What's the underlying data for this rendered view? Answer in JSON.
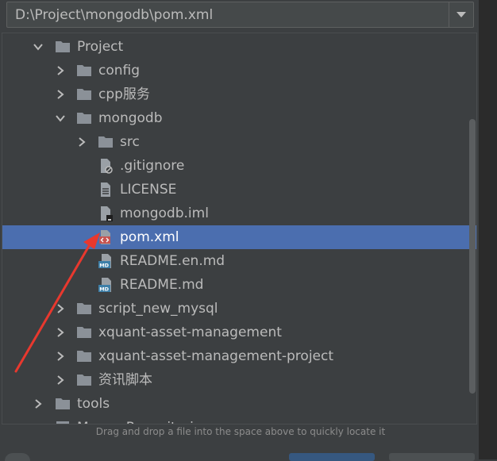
{
  "path_value": "D:\\Project\\mongodb\\pom.xml",
  "hint": "Drag and drop a file into the space above to quickly locate it",
  "tree": {
    "project": "Project",
    "config": "config",
    "cpp": "cpp服务",
    "mongodb": "mongodb",
    "src": "src",
    "gitignore": ".gitignore",
    "license": "LICENSE",
    "iml": "mongodb.iml",
    "pom": "pom.xml",
    "readme_en": "README.en.md",
    "readme": "README.md",
    "script": "script_new_mysql",
    "xqam": "xquant-asset-management",
    "xqamp": "xquant-asset-management-project",
    "zixun": "资讯脚本",
    "tools": "tools",
    "partial": "Maven Repositories"
  },
  "colors": {
    "selection": "#4b6eaf",
    "folder": "#8b9198",
    "annotation_arrow": "#e8382e"
  }
}
